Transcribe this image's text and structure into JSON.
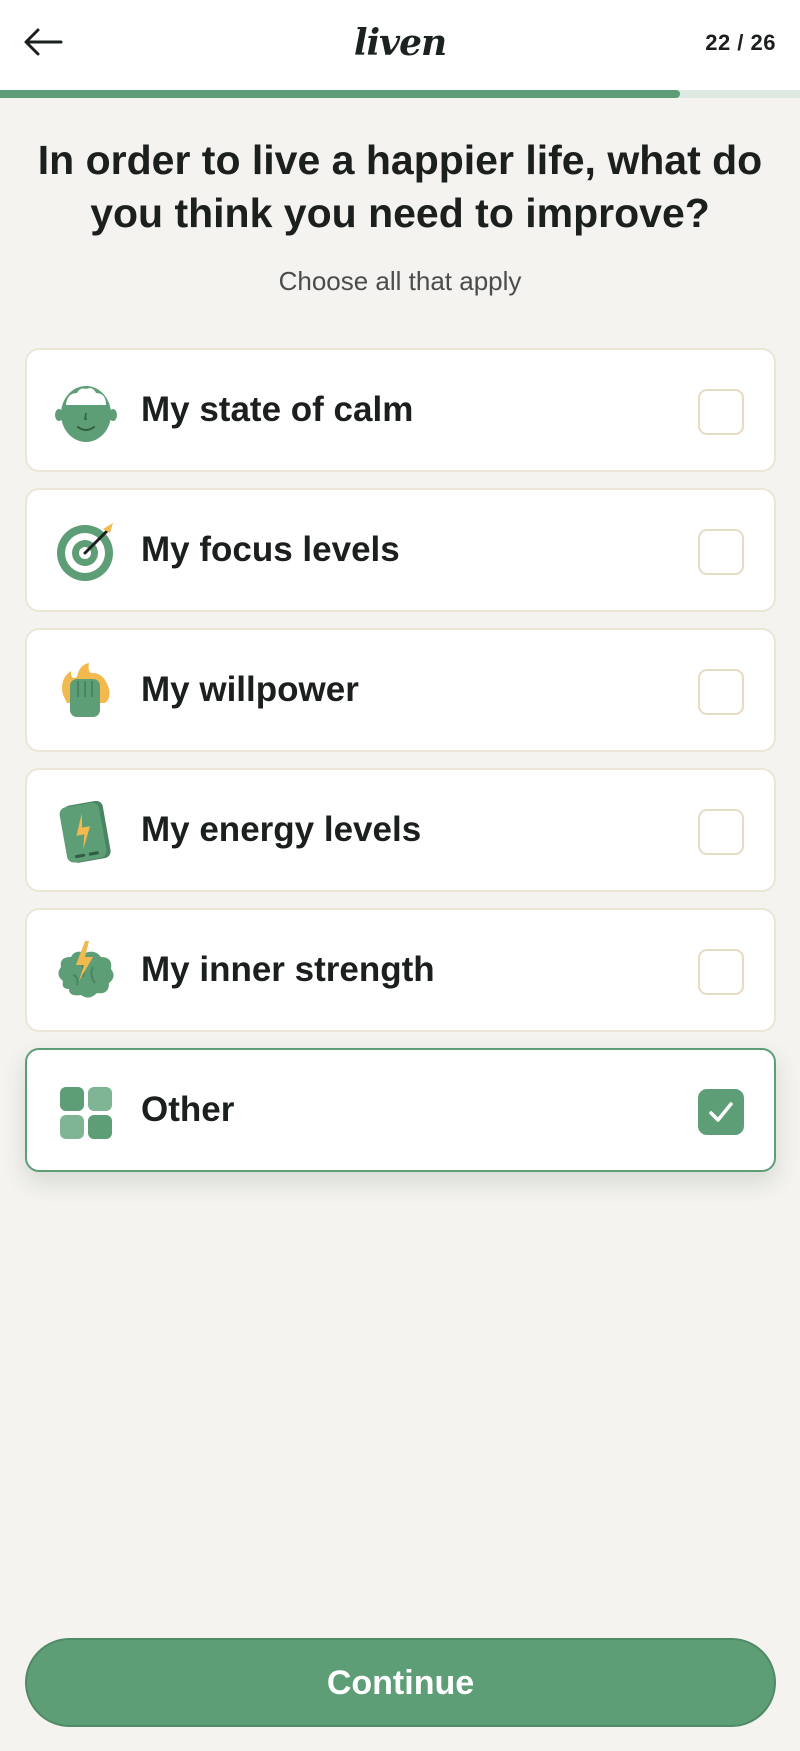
{
  "header": {
    "logo": "liven",
    "step": "22 / 26",
    "back_icon": "arrow-left-icon"
  },
  "progress": {
    "current": 22,
    "total": 26,
    "fraction": 0.85,
    "color": "#5e9e76"
  },
  "question": {
    "title": "In order to live a happier life, what do you think you need to improve?",
    "subtitle": "Choose all that apply"
  },
  "options": [
    {
      "label": "My state of calm",
      "icon": "calm-head-icon",
      "checked": false
    },
    {
      "label": "My focus levels",
      "icon": "target-icon",
      "checked": false
    },
    {
      "label": "My willpower",
      "icon": "fist-fire-icon",
      "checked": false
    },
    {
      "label": "My energy levels",
      "icon": "battery-icon",
      "checked": false
    },
    {
      "label": "My inner strength",
      "icon": "brain-lightning-icon",
      "checked": false
    },
    {
      "label": "Other",
      "icon": "grid-icon",
      "checked": true
    }
  ],
  "continue_button": {
    "label": "Continue"
  },
  "colors": {
    "accent": "#5e9e76",
    "background": "#f4f3ef",
    "card_border": "#ece6d6",
    "icon_orange": "#f2b94f"
  }
}
